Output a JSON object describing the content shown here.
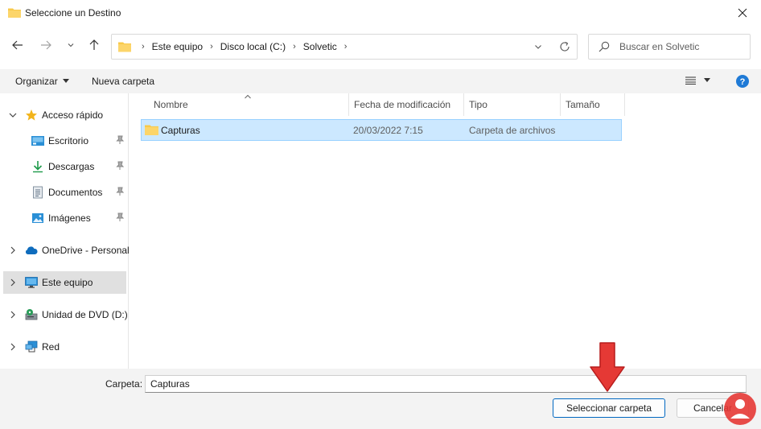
{
  "window": {
    "title": "Seleccione un Destino"
  },
  "address": {
    "crumbs": [
      "Este equipo",
      "Disco local (C:)",
      "Solvetic"
    ]
  },
  "search": {
    "placeholder": "Buscar en Solvetic"
  },
  "toolbar": {
    "organize": "Organizar",
    "new_folder": "Nueva carpeta"
  },
  "sidebar": {
    "items": [
      {
        "label": "Acceso rápido",
        "icon": "star-icon"
      },
      {
        "label": "Escritorio",
        "icon": "desktop-icon"
      },
      {
        "label": "Descargas",
        "icon": "download-icon"
      },
      {
        "label": "Documentos",
        "icon": "documents-icon"
      },
      {
        "label": "Imágenes",
        "icon": "pictures-icon"
      },
      {
        "label": "OneDrive - Personal",
        "icon": "onedrive-icon"
      },
      {
        "label": "Este equipo",
        "icon": "computer-icon"
      },
      {
        "label": "Unidad de DVD (D:)",
        "icon": "dvd-icon"
      },
      {
        "label": "Red",
        "icon": "network-icon"
      }
    ]
  },
  "columns": {
    "name": "Nombre",
    "modified": "Fecha de modificación",
    "type": "Tipo",
    "size": "Tamaño"
  },
  "files": [
    {
      "name": "Capturas",
      "modified": "20/03/2022 7:15",
      "type": "Carpeta de archivos",
      "size": ""
    }
  ],
  "footer": {
    "folder_label": "Carpeta:",
    "folder_value": "Capturas",
    "select_button": "Seleccionar carpeta",
    "cancel_button": "Cancelar"
  },
  "colors": {
    "selection": "#cce8ff",
    "accent": "#0067c0",
    "annotation_arrow": "#e53935"
  }
}
